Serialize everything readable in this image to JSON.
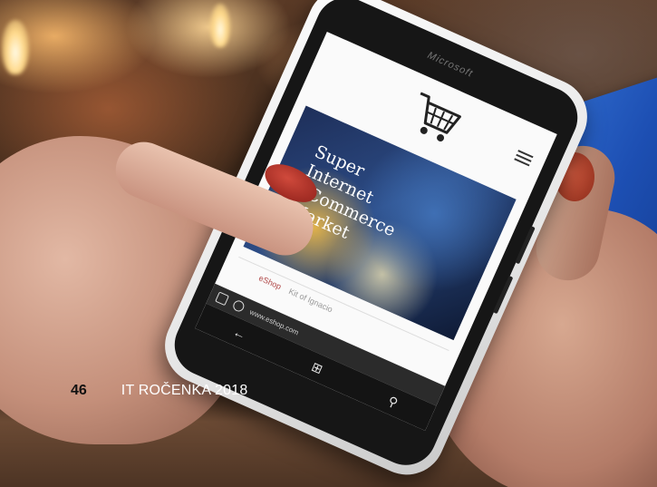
{
  "footer": {
    "page_number": "46",
    "publication": "IT ROČENKA 2018"
  },
  "phone": {
    "brand": "Microsoft",
    "banner_lines": [
      "Super",
      "Internet",
      "eCommerce",
      "Market"
    ],
    "tabs": [
      "eShop",
      "Kit of Ignacio"
    ],
    "url": "www.eshop.com"
  },
  "colors": {
    "card_blue": "#1d4fb3",
    "nail_red": "#b8322a",
    "phone_white": "#f2f2f2"
  },
  "icons": [
    "cart-icon",
    "menu-icon",
    "back-arrow-icon",
    "home-icon",
    "search-icon"
  ]
}
